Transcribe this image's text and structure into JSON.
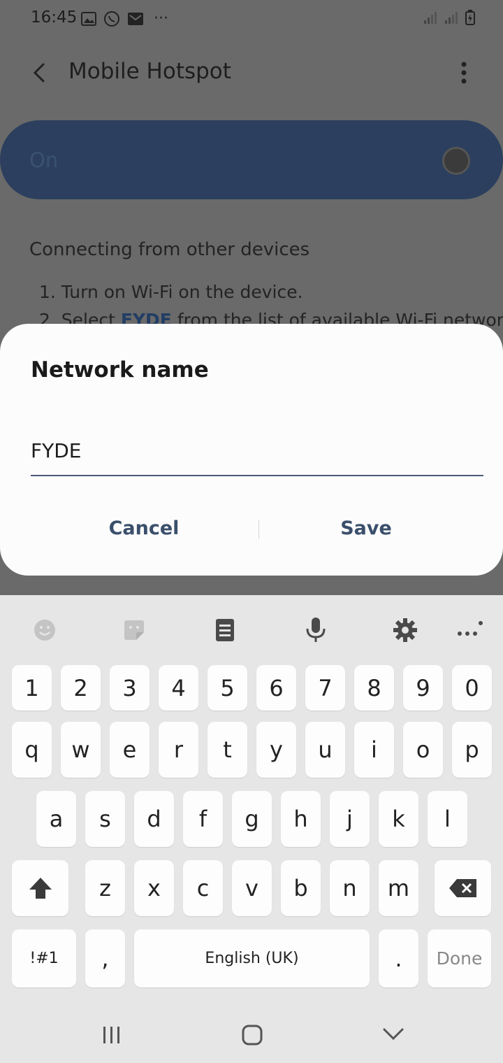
{
  "status_bar": {
    "time": "16:45",
    "more": "···"
  },
  "app_bar": {
    "title": "Mobile Hotspot"
  },
  "switch": {
    "label": "On"
  },
  "instructions": {
    "title": "Connecting from other devices",
    "step1": "1.  Turn on Wi-Fi on the device.",
    "step2_prefix": "2.  Select ",
    "step2_ssid": "FYDE",
    "step2_suffix": " from the list of available Wi-Fi networks"
  },
  "dialog": {
    "title": "Network name",
    "value": "FYDE",
    "cancel_label": "Cancel",
    "save_label": "Save"
  },
  "keyboard": {
    "row_numbers": [
      "1",
      "2",
      "3",
      "4",
      "5",
      "6",
      "7",
      "8",
      "9",
      "0"
    ],
    "row_top": [
      "q",
      "w",
      "e",
      "r",
      "t",
      "y",
      "u",
      "i",
      "o",
      "p"
    ],
    "row_mid": [
      "a",
      "s",
      "d",
      "f",
      "g",
      "h",
      "j",
      "k",
      "l"
    ],
    "row_bottom": [
      "z",
      "x",
      "c",
      "v",
      "b",
      "n",
      "m"
    ],
    "symbols_label": "!#1",
    "comma_label": ",",
    "space_label": "English (UK)",
    "period_label": ".",
    "done_label": "Done"
  }
}
